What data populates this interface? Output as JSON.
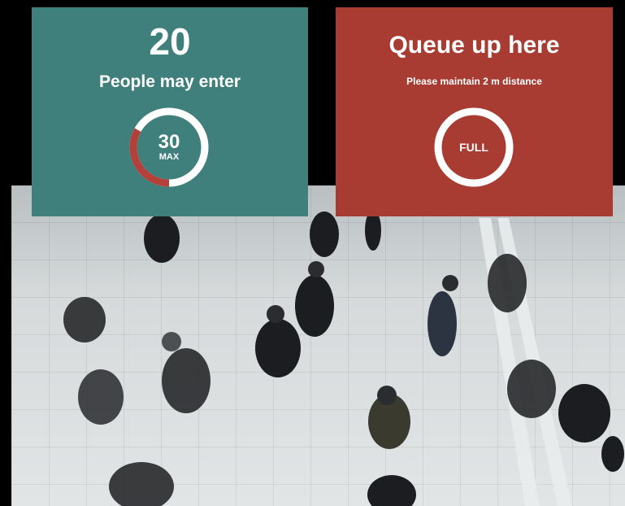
{
  "entry_panel": {
    "count": "20",
    "label": "People may enter",
    "gauge": {
      "max_value": "30",
      "max_label": "MAX",
      "occupied_fraction": 0.33
    }
  },
  "queue_panel": {
    "headline": "Queue up here",
    "note": "Please maintain 2 m distance",
    "gauge_label": "FULL"
  },
  "colors": {
    "entry_bg": "#3f7f7c",
    "queue_bg": "#a83c33",
    "gauge_occupied": "#b3413a",
    "gauge_ring": "#ffffff"
  }
}
